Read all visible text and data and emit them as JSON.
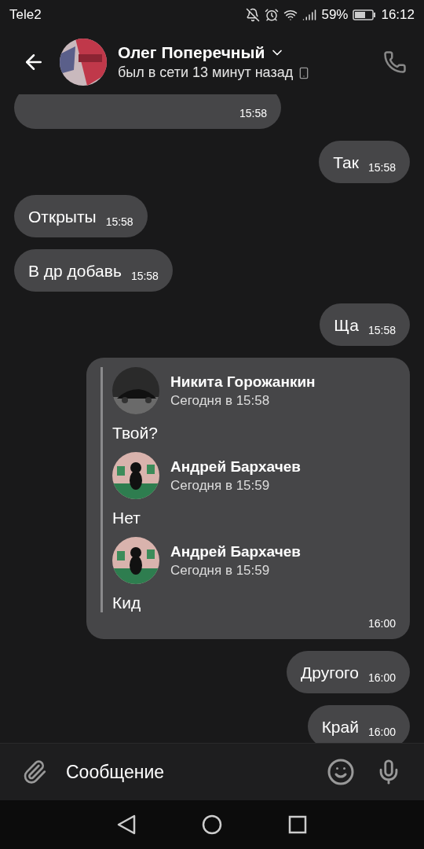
{
  "status_bar": {
    "carrier": "Tele2",
    "battery": "59%",
    "time": "16:12"
  },
  "header": {
    "name": "Олег Поперечный",
    "status": "был в сети 13 минут назад"
  },
  "messages": [
    {
      "kind": "text",
      "time": "15:58"
    },
    {
      "kind": "text",
      "outgoing": true,
      "text": "Так",
      "time": "15:58"
    },
    {
      "kind": "text",
      "outgoing": false,
      "text": "Открыты",
      "time": "15:58"
    },
    {
      "kind": "text",
      "outgoing": false,
      "text": "В др добавь",
      "time": "15:58"
    },
    {
      "kind": "text",
      "outgoing": true,
      "text": "Ща",
      "time": "15:58"
    },
    {
      "kind": "forward",
      "time": "16:00",
      "items": [
        {
          "author": "Никита Горожанкин",
          "date": "Сегодня в 15:58",
          "text": "Твой?"
        },
        {
          "author": "Андрей Бархачев",
          "date": "Сегодня в 15:59",
          "text": "Нет"
        },
        {
          "author": "Андрей Бархачев",
          "date": "Сегодня в 15:59",
          "text": "Кид"
        }
      ]
    },
    {
      "kind": "text",
      "outgoing": true,
      "text": "Другого",
      "time": "16:00"
    },
    {
      "kind": "text",
      "outgoing": true,
      "text": "Край",
      "time": "16:00"
    }
  ],
  "composer": {
    "placeholder": "Сообщение"
  }
}
